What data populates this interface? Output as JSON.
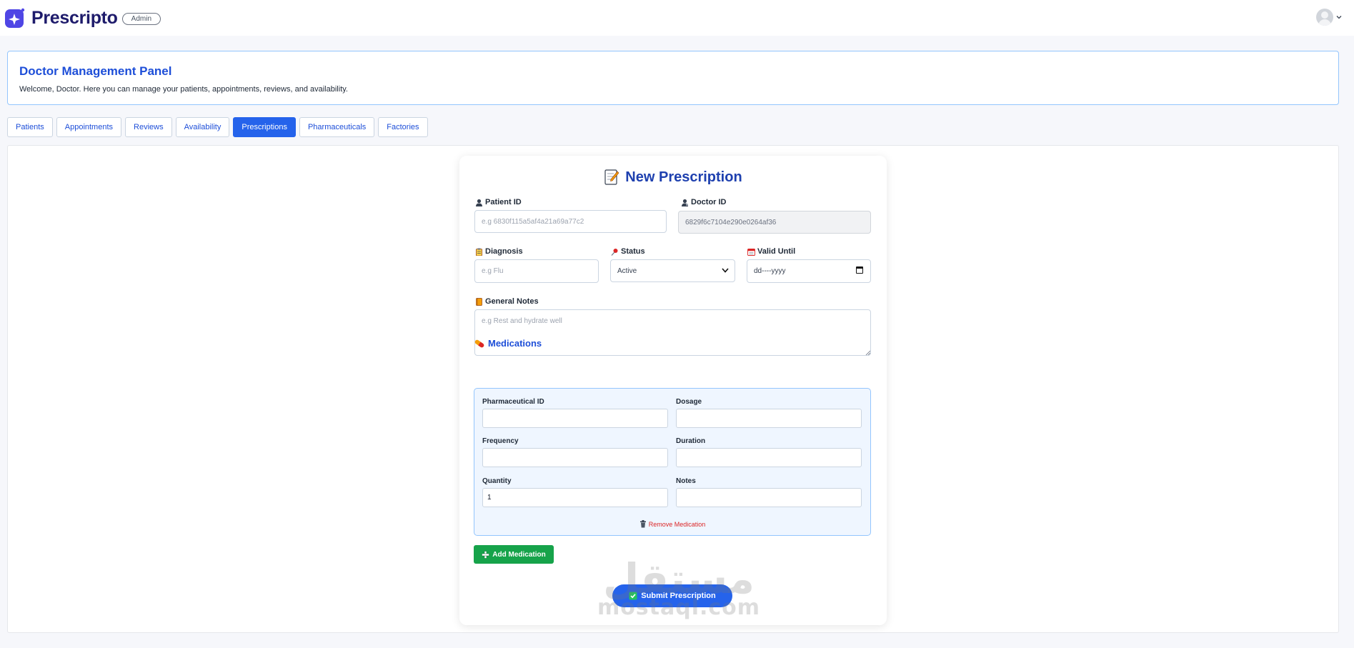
{
  "app": {
    "brand": "Prescripto",
    "role_badge": "Admin"
  },
  "panel": {
    "title": "Doctor Management Panel",
    "subtitle": "Welcome, Doctor. Here you can manage your patients, appointments, reviews, and availability."
  },
  "tabs": [
    {
      "label": "Patients",
      "active": false
    },
    {
      "label": "Appointments",
      "active": false
    },
    {
      "label": "Reviews",
      "active": false
    },
    {
      "label": "Availability",
      "active": false
    },
    {
      "label": "Prescriptions",
      "active": true
    },
    {
      "label": "Pharmaceuticals",
      "active": false
    },
    {
      "label": "Factories",
      "active": false
    }
  ],
  "form": {
    "title": "New Prescription",
    "title_icon": "memo-icon",
    "patient_id": {
      "label": "Patient ID",
      "icon": "patient-icon",
      "placeholder": "e.g 6830f115a5af4a21a69a77c2",
      "value": ""
    },
    "doctor_id": {
      "label": "Doctor ID",
      "icon": "doctor-icon",
      "value": "6829f6c7104e290e0264af36"
    },
    "diagnosis": {
      "label": "Diagnosis",
      "icon": "clipboard-icon",
      "placeholder": "e.g Flu",
      "value": ""
    },
    "status": {
      "label": "Status",
      "icon": "pushpin-icon",
      "value": "Active"
    },
    "valid_until": {
      "label": "Valid Until",
      "icon": "calendar-icon",
      "value": "dd----yyyy"
    },
    "general_notes": {
      "label": "General Notes",
      "icon": "notebook-icon",
      "placeholder": "e.g Rest and hydrate well",
      "value": ""
    },
    "medications": {
      "heading": "Medications",
      "icon": "pill-icon",
      "pharmaceutical_id": {
        "label": "Pharmaceutical ID",
        "value": ""
      },
      "dosage": {
        "label": "Dosage",
        "value": ""
      },
      "frequency": {
        "label": "Frequency",
        "value": ""
      },
      "duration": {
        "label": "Duration",
        "value": ""
      },
      "quantity": {
        "label": "Quantity",
        "value": "1"
      },
      "notes": {
        "label": "Notes",
        "value": ""
      },
      "remove_label": "Remove Medication"
    },
    "add_medication_label": "Add Medication",
    "submit_label": "Submit Prescription"
  },
  "watermark": {
    "arabic": "مستقل",
    "latin": "mostaql.com"
  },
  "colors": {
    "primary": "#2563eb",
    "brand_dark": "#1e1b6b",
    "success": "#16a34a",
    "danger": "#dc2626"
  }
}
